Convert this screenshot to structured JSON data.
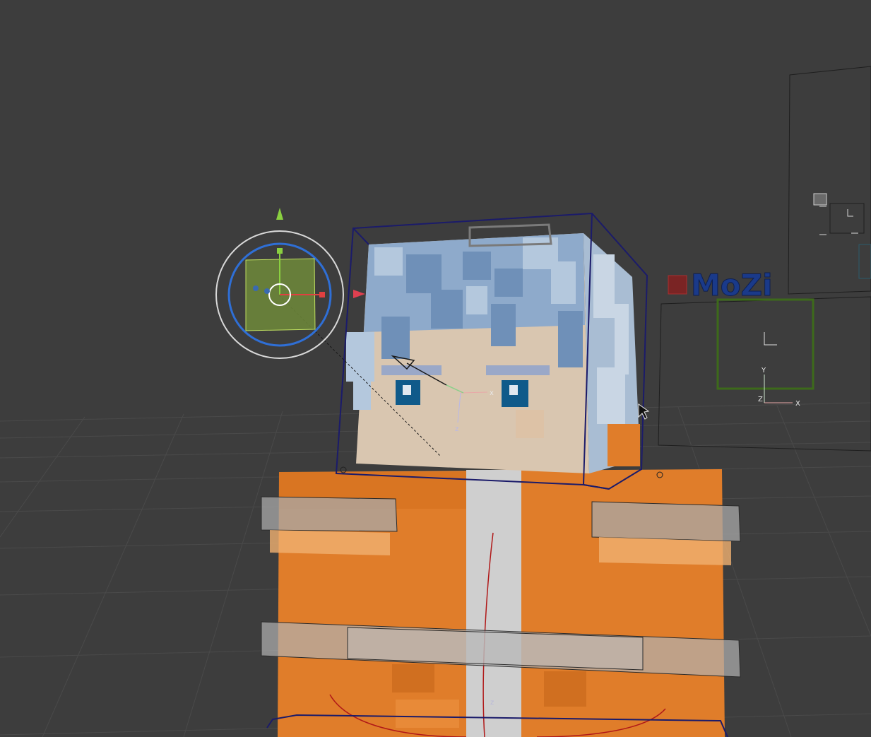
{
  "viewport": {
    "background": "#3d3d3d",
    "grid_color": "#4a4a4a"
  },
  "scene_text": {
    "logo": "MoZi",
    "axis_x": "x",
    "axis_z": "z",
    "empty_y": "Y",
    "empty_x": "X",
    "empty_z": "Z",
    "body_z": "z"
  },
  "colors": {
    "hair": "#8eaacb",
    "skin": "#d9c6b0",
    "eye": "#0f5a8a",
    "shirt": "#e07d2a",
    "stripe": "#cfcfcf",
    "selection_box": "#1b1b6a",
    "light_gizmo_ring": "#2f6fd6",
    "light_gizmo_fill": "#6f8a3a",
    "logo": "#1a3a8a",
    "frame_green": "#3d6a1a",
    "armature_red": "#b01818"
  },
  "icons": [
    "light-gizmo-icon",
    "camera-icon",
    "mouse-cursor-icon",
    "origin-marker-icon"
  ]
}
